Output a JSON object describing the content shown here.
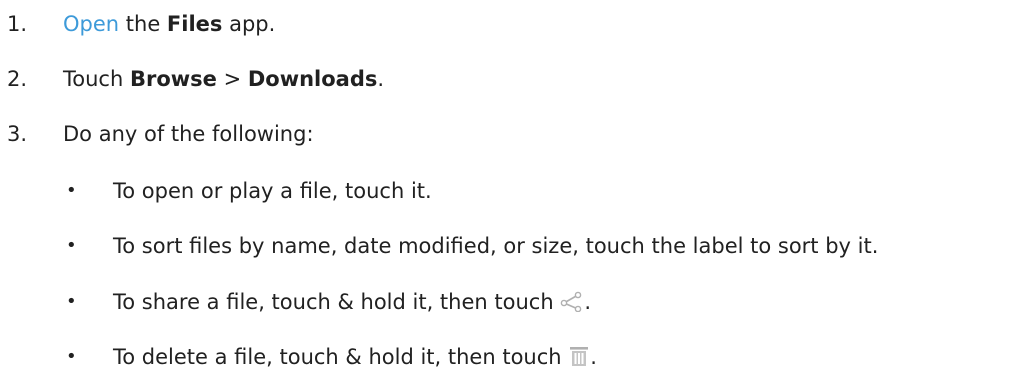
{
  "steps": [
    {
      "number": "1.",
      "link": "Open",
      "text_a": " the ",
      "bold_a": "Files",
      "text_b": " app."
    },
    {
      "number": "2.",
      "text_a": "Touch ",
      "bold_a": "Browse",
      "text_b": " > ",
      "bold_b": "Downloads",
      "text_c": "."
    },
    {
      "number": "3.",
      "text_a": "Do any of the following:"
    }
  ],
  "bullets": [
    {
      "text": "To open or play a file, touch it."
    },
    {
      "text": "To sort files by name, date modified, or size, touch the label to sort by it."
    },
    {
      "text": "To share a file, touch & hold it, then touch ",
      "icon": "share-icon",
      "after": "."
    },
    {
      "text": "To delete a file, touch & hold it, then touch ",
      "icon": "trash-icon",
      "after": "."
    }
  ],
  "bullet_char": "•",
  "colors": {
    "text": "#212121",
    "link": "#3d9ad9",
    "icon": "#b0b0b0"
  }
}
